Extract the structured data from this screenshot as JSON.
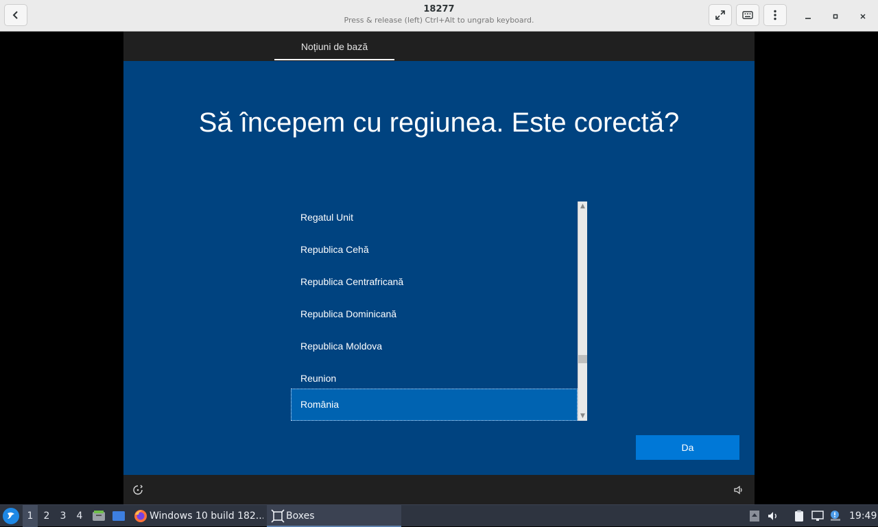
{
  "headerbar": {
    "title": "18277",
    "subtitle": "Press & release (left) Ctrl+Alt to ungrab keyboard."
  },
  "vm": {
    "tab_label": "Noțiuni de bază",
    "heading": "Să începem cu regiunea. Este corectă?",
    "regions": [
      {
        "label": "Regatul Unit",
        "selected": false
      },
      {
        "label": "Republica Cehă",
        "selected": false
      },
      {
        "label": "Republica Centrafricană",
        "selected": false
      },
      {
        "label": "Republica Dominicană",
        "selected": false
      },
      {
        "label": "Republica Moldova",
        "selected": false
      },
      {
        "label": "Reunion",
        "selected": false
      },
      {
        "label": "România",
        "selected": true
      }
    ],
    "confirm_label": "Da",
    "colors": {
      "background": "#004380",
      "selected": "#0063b1",
      "button": "#0078d7"
    }
  },
  "taskbar": {
    "workspaces": [
      "1",
      "2",
      "3",
      "4"
    ],
    "active_workspace": "1",
    "tasks": [
      {
        "label": "Windows 10 build 182...",
        "icon": "firefox-icon"
      },
      {
        "label": "Boxes",
        "icon": "boxes-icon"
      }
    ],
    "clock": "19:49"
  }
}
